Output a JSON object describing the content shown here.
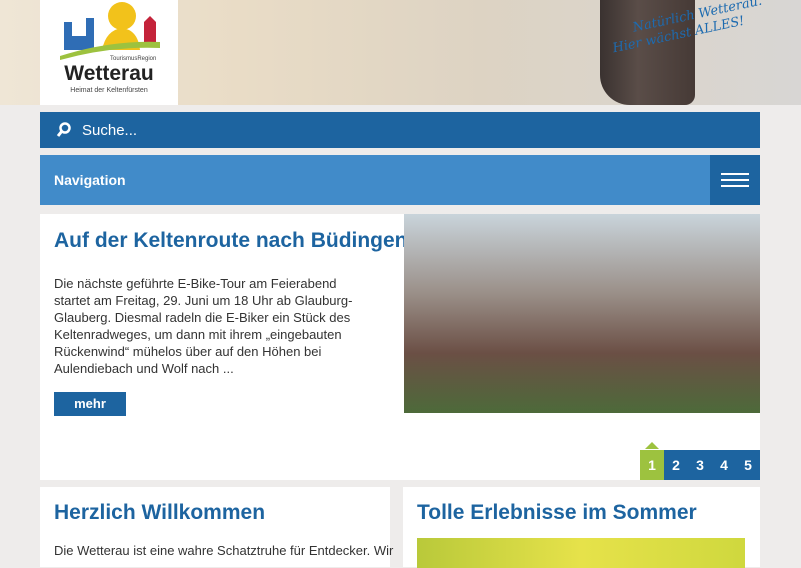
{
  "header": {
    "logo": {
      "brand": "Wetterau",
      "tagline_top": "TourismusRegion",
      "tagline_bottom": "Heimat der Keltenfürsten"
    },
    "slogan_line1": "Natürlich Wetterau.",
    "slogan_line2": "Hier wächst ALLES!"
  },
  "search": {
    "placeholder": "Suche..."
  },
  "nav": {
    "label": "Navigation"
  },
  "featured": {
    "title": "Auf der Keltenroute nach Büdingen",
    "text": "Die nächste geführte E-Bike-Tour am Feierabend startet am Freitag, 29. Juni um 18 Uhr ab Glauburg-Glauberg. Diesmal radeln die E-Biker ein Stück des Keltenradweges, um dann mit ihrem „eingebauten Rückenwind“ mühelos über auf den Höhen bei Aulendiebach und Wolf nach ...",
    "more": "mehr",
    "pages": [
      "1",
      "2",
      "3",
      "4",
      "5"
    ],
    "active_page": 1
  },
  "welcome": {
    "title": "Herzlich Willkommen",
    "text": "Die Wetterau ist eine wahre Schatztruhe für Entdecker. Wir"
  },
  "summer": {
    "title": "Tolle Erlebnisse im Sommer"
  }
}
